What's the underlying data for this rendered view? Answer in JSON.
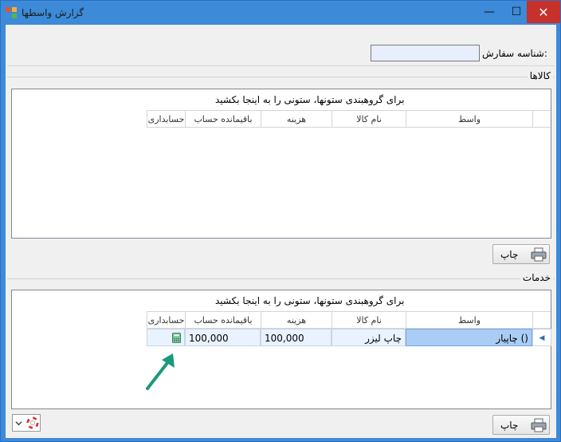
{
  "window": {
    "title": "گزارش واسطها",
    "controls": {
      "minimize": "—",
      "maximize": "☐",
      "close": "✕"
    }
  },
  "filter": {
    "order_id_label": "شناسه سفارش:",
    "order_id_value": ""
  },
  "goods": {
    "group_label": "کالاها",
    "group_hint": "برای گروهبندی ستونها، ستونی را به اینجا بکشید",
    "columns": [
      "واسط",
      "نام کالا",
      "هزینه",
      "باقیمانده حساب",
      "حسابداری"
    ],
    "rows": [],
    "print_label": "چاپ"
  },
  "services": {
    "group_label": "خدمات",
    "group_hint": "برای گروهبندی ستونها، ستونی را به اینجا بکشید",
    "columns": [
      "واسط",
      "نام کالا",
      "هزینه",
      "باقیمانده حساب",
      "حسابداری"
    ],
    "rows": [
      {
        "vendor": "چاپیار ()",
        "product": "چاپ لیزر",
        "cost": "100,000",
        "balance": "100,000",
        "accounting_icon": "calculator-icon"
      }
    ],
    "print_label": "چاپ"
  },
  "colors": {
    "title_bar": "#3c8ad8",
    "close_button": "#c8302b",
    "selected_cell": "#a9cdf5",
    "arrow": "#1a9a7a"
  }
}
